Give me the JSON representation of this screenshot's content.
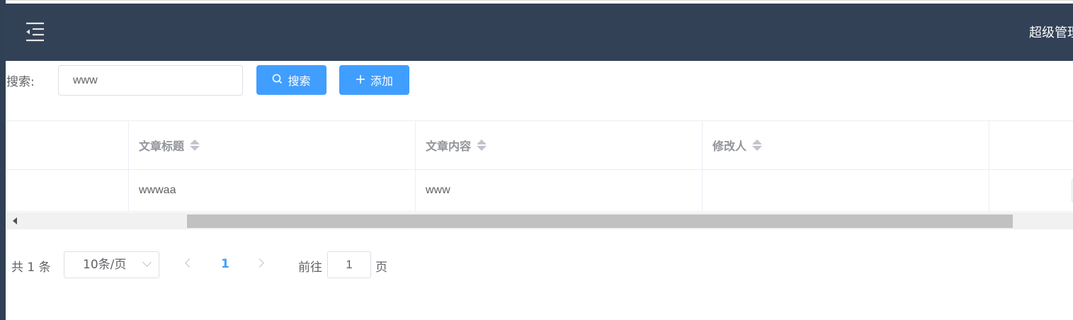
{
  "header": {
    "menu_icon": "hamburger-fold-icon",
    "user_name": "超级管理员",
    "background": "#334157"
  },
  "search": {
    "label": "搜索:",
    "value": "www",
    "search_button": "搜索",
    "add_button": "添加",
    "search_icon": "search-icon",
    "add_icon": "plus-icon"
  },
  "table": {
    "columns": [
      "文章标题",
      "文章内容",
      "修改人"
    ],
    "rows": [
      {
        "title": "wwwaa",
        "content": "www",
        "modifier": ""
      }
    ]
  },
  "pagination": {
    "total": "共 1 条",
    "page_size": "10条/页",
    "current_page": "1",
    "goto_label": "前往",
    "goto_value": "1",
    "goto_suffix": "页"
  },
  "colors": {
    "accent": "#409eff",
    "header_bg": "#334157"
  }
}
